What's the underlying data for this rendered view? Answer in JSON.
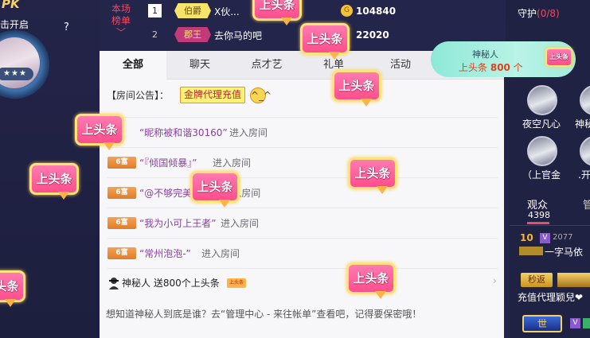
{
  "host": {
    "pk_label": "PK",
    "caption": "击开启",
    "help_label": "?",
    "stars": "★★★"
  },
  "ranking": {
    "title": "本场榜单",
    "rows": [
      {
        "rank": "1",
        "badge": "伯爵",
        "name": "X伙...",
        "score": "104840",
        "coin": "G"
      },
      {
        "rank": "2",
        "badge": "郡王",
        "name": "去你马的吧",
        "score": "22020"
      }
    ]
  },
  "chat": {
    "tabs": [
      "全部",
      "聊天",
      "点才艺",
      "礼单",
      "活动"
    ],
    "announcement": {
      "label": "【房间公告】：",
      "tag": "金牌代理充值",
      "emoji": "^_^"
    },
    "messages": [
      {
        "level": "",
        "name": "“昵称被和谐30160”",
        "suffix": "进入房间"
      },
      {
        "level": "6富",
        "name": "“『倾国倾暴』”",
        "suffix": "进入房间"
      },
      {
        "level": "6富",
        "name": "“@不够完美",
        "suffix": "”进入房间"
      },
      {
        "level": "6富",
        "name": "“我为小可上王者”",
        "suffix": "进入房间"
      },
      {
        "level": "6富",
        "name": "“常州泡泡-”",
        "suffix": "进入房间"
      }
    ],
    "gift": {
      "text": "神秘人 送800个上头条",
      "badge": "上头条"
    },
    "tip": "想知道神秘人到底是谁？去“管理中心 - 来往帐单”查看吧，记得要保密哦！"
  },
  "mystery_gift": {
    "name": "神秘人",
    "gift_label": "上头条",
    "count": "800",
    "unit": "个"
  },
  "guard": {
    "title": "守护",
    "count": "(0/8)",
    "members": [
      "夜空凡心",
      "神秘",
      "（上官金",
      ".开"
    ]
  },
  "audience": {
    "label": "观众",
    "count": "4398",
    "other_tab": "管",
    "rows": [
      {
        "level": "10",
        "id": "2077",
        "name": "一字马依"
      },
      {
        "level": "秒返",
        "name": "充值代理颖兒❤"
      },
      {
        "level": "世",
        "name": "V"
      }
    ]
  },
  "headline_label": "上头条",
  "colors": {
    "accent": "#e94d6a",
    "panel_bg": "#f7f7f9",
    "headline_pink": "#ff4e8c",
    "headline_gold": "#ffe27a",
    "level_orange": "#e07c27",
    "pill_mint": "#a2ecdc"
  }
}
